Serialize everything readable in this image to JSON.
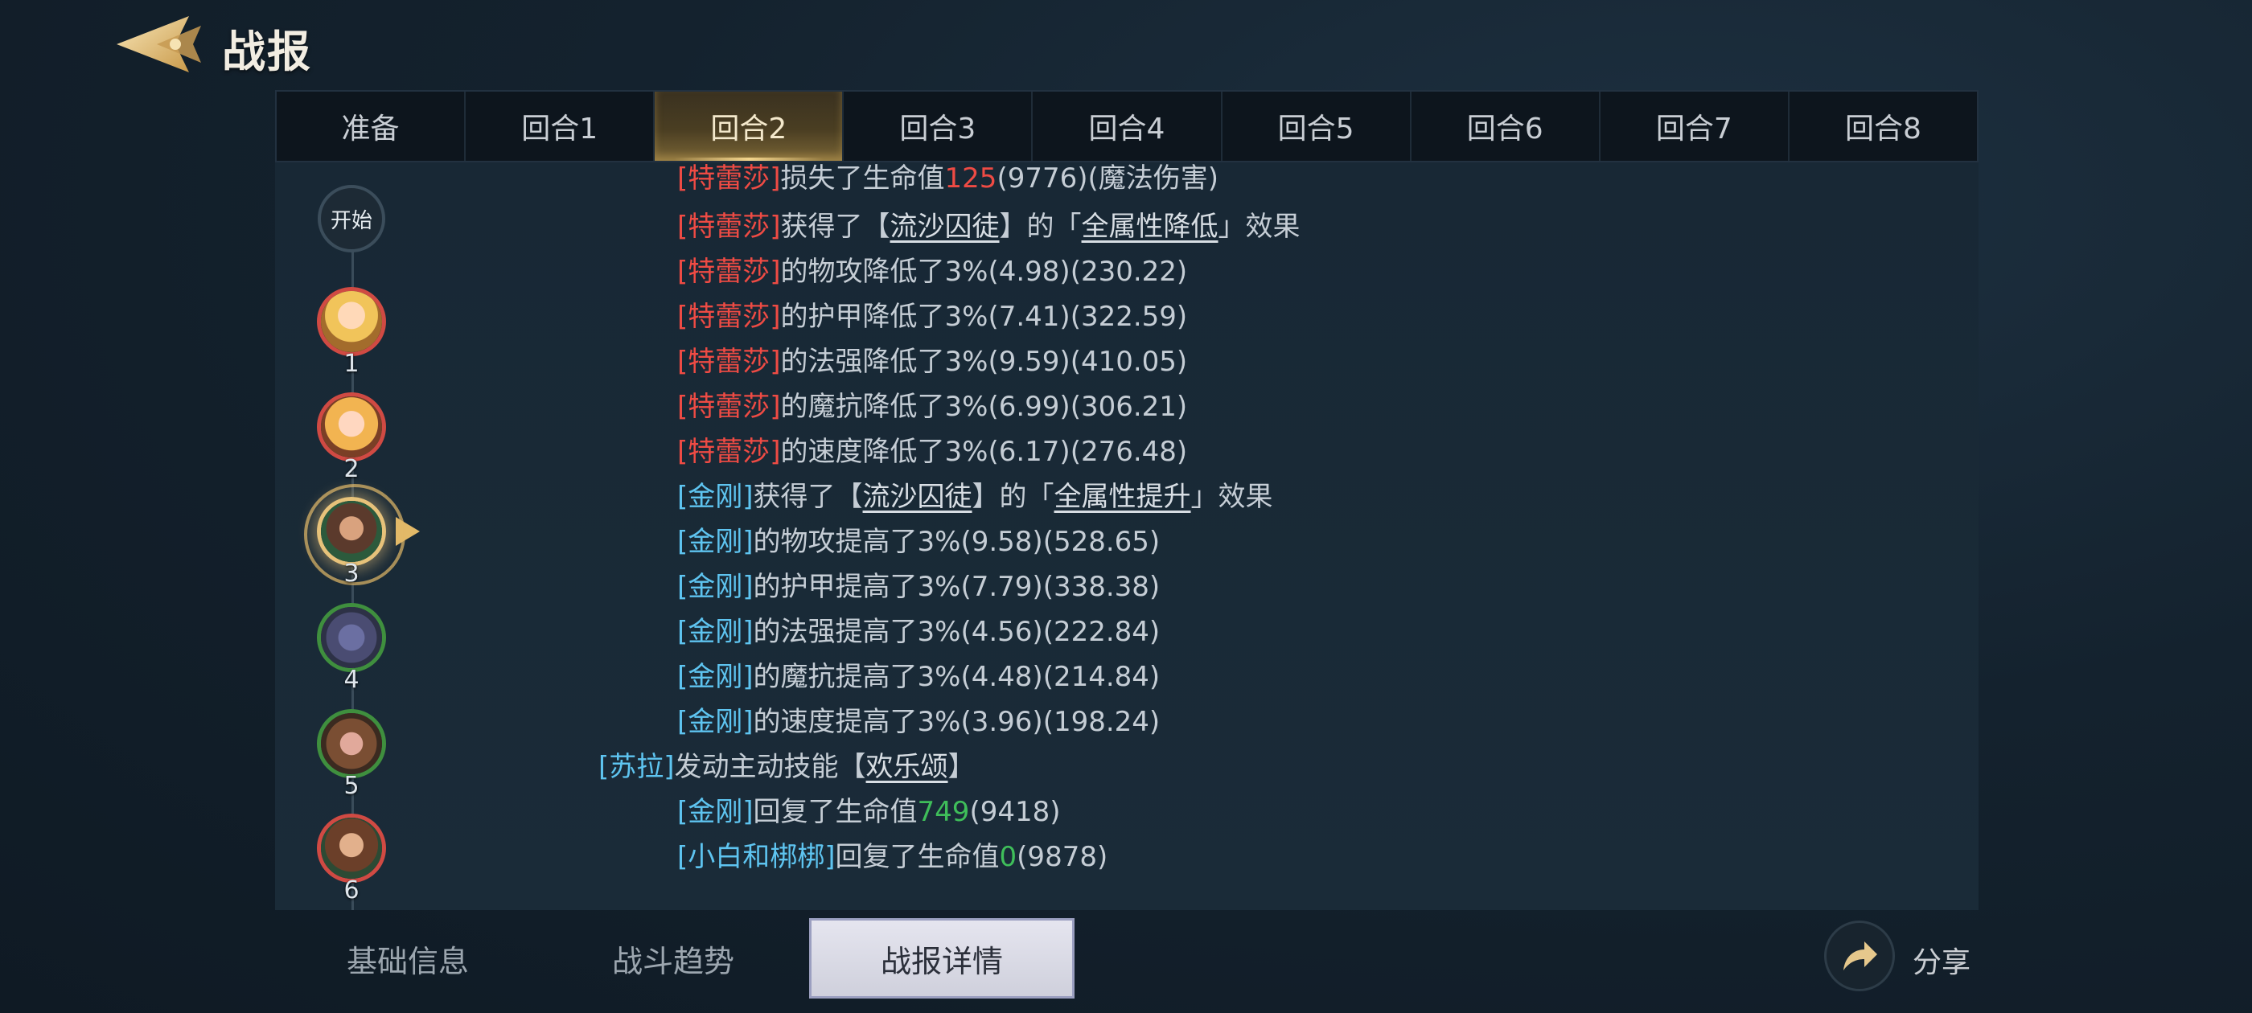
{
  "header": {
    "title": "战报"
  },
  "tabs": [
    {
      "label": "准备",
      "active": false
    },
    {
      "label": "回合1",
      "active": false
    },
    {
      "label": "回合2",
      "active": true
    },
    {
      "label": "回合3",
      "active": false
    },
    {
      "label": "回合4",
      "active": false
    },
    {
      "label": "回合5",
      "active": false
    },
    {
      "label": "回合6",
      "active": false
    },
    {
      "label": "回合7",
      "active": false
    },
    {
      "label": "回合8",
      "active": false
    }
  ],
  "timeline": {
    "start_label": "开始",
    "nodes": [
      "1",
      "2",
      "3",
      "4",
      "5",
      "6"
    ]
  },
  "log": {
    "l0": {
      "name": "[特蕾莎]",
      "t1": "损失了生命值",
      "n": "125",
      "t2": "(9776)(魔法伤害)"
    },
    "l1": {
      "name": "[特蕾莎]",
      "t1": "获得了【",
      "skill": "流沙囚徒",
      "t2": "】的「",
      "effect": "全属性降低",
      "t3": "」效果"
    },
    "l2": {
      "name": "[特蕾莎]",
      "t": "的物攻降低了3%(4.98)(230.22)"
    },
    "l3": {
      "name": "[特蕾莎]",
      "t": "的护甲降低了3%(7.41)(322.59)"
    },
    "l4": {
      "name": "[特蕾莎]",
      "t": "的法强降低了3%(9.59)(410.05)"
    },
    "l5": {
      "name": "[特蕾莎]",
      "t": "的魔抗降低了3%(6.99)(306.21)"
    },
    "l6": {
      "name": "[特蕾莎]",
      "t": "的速度降低了3%(6.17)(276.48)"
    },
    "l7": {
      "name": "[金刚]",
      "t1": "获得了【",
      "skill": "流沙囚徒",
      "t2": "】的「",
      "effect": "全属性提升",
      "t3": "」效果"
    },
    "l8": {
      "name": "[金刚]",
      "t": "的物攻提高了3%(9.58)(528.65)"
    },
    "l9": {
      "name": "[金刚]",
      "t": "的护甲提高了3%(7.79)(338.38)"
    },
    "l10": {
      "name": "[金刚]",
      "t": "的法强提高了3%(4.56)(222.84)"
    },
    "l11": {
      "name": "[金刚]",
      "t": "的魔抗提高了3%(4.48)(214.84)"
    },
    "l12": {
      "name": "[金刚]",
      "t": "的速度提高了3%(3.96)(198.24)"
    },
    "l13": {
      "name": "[苏拉]",
      "t1": "发动主动技能【",
      "skill": "欢乐颂",
      "t2": "】"
    },
    "l14": {
      "name": "[金刚]",
      "t1": "回复了生命值",
      "n": "749",
      "t2": "(9418)"
    },
    "l15": {
      "name": "[小白和梆梆]",
      "t1": "回复了生命值",
      "n": "0",
      "t2": "(9878)"
    }
  },
  "bottom_tabs": [
    {
      "label": "基础信息",
      "active": false
    },
    {
      "label": "战斗趋势",
      "active": false
    },
    {
      "label": "战报详情",
      "active": true
    }
  ],
  "share": {
    "label": "分享",
    "icon": "share-arrow-icon"
  },
  "colors": {
    "enemy_name": "#ee4b44",
    "ally_name": "#5ec4f0",
    "heal": "#3fbe5a",
    "gold_accent": "#e7c27a"
  }
}
